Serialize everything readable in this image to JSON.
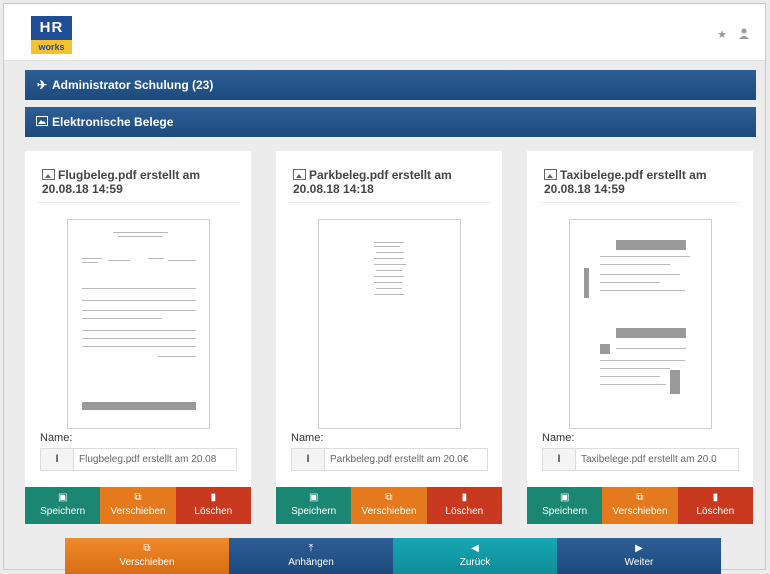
{
  "header": {
    "logo_top": "HR",
    "logo_bottom": "works",
    "star_icon": "star-icon",
    "user_icon": "user-icon"
  },
  "bars": {
    "course_title": "Administrator Schulung (23)",
    "receipts_title": "Elektronische Belege"
  },
  "cards": [
    {
      "title": "Flugbeleg.pdf erstellt am 20.08.18 14:59",
      "name_label": "Name:",
      "name_value": "Flugbeleg.pdf erstellt am 20.08",
      "save": "Speichern",
      "move": "Verschieben",
      "delete": "Löschen"
    },
    {
      "title": "Parkbeleg.pdf erstellt am 20.08.18 14:18",
      "name_label": "Name:",
      "name_value": "Parkbeleg.pdf erstellt am 20.0€",
      "save": "Speichern",
      "move": "Verschieben",
      "delete": "Löschen"
    },
    {
      "title": "Taxibelege.pdf erstellt am 20.08.18 14:59",
      "name_label": "Name:",
      "name_value": "Taxibelege.pdf erstellt am 20.0",
      "save": "Speichern",
      "move": "Verschieben",
      "delete": "Löschen"
    }
  ],
  "footer": {
    "move": "Verschieben",
    "attach": "Anhängen",
    "back": "Zurück",
    "next": "Weiter"
  },
  "colors": {
    "bar_blue": "#1d4a7d",
    "green": "#1b8773",
    "orange": "#e47a1d",
    "red": "#c8391f",
    "teal": "#0f8d99"
  }
}
